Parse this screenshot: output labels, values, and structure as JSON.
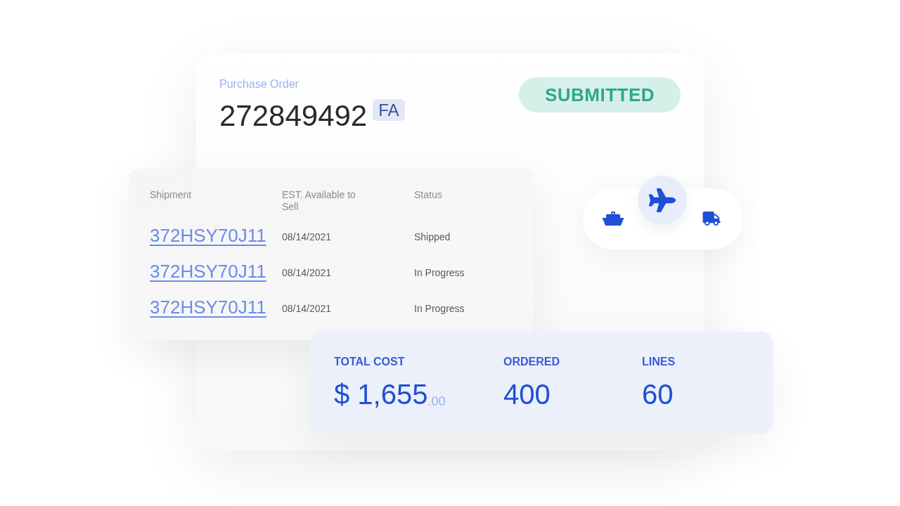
{
  "purchase_order": {
    "label": "Purchase Order",
    "number": "272849492",
    "badge": "FA",
    "status": "SUBMITTED"
  },
  "shipments": {
    "columns": [
      "Shipment",
      "EST. Available to Sell",
      "Status"
    ],
    "rows": [
      {
        "shipment": "372HSY70J11",
        "available": "08/14/2021",
        "status": "Shipped"
      },
      {
        "shipment": "372HSY70J11",
        "available": "08/14/2021",
        "status": "In Progress"
      },
      {
        "shipment": "372HSY70J11",
        "available": "08/14/2021",
        "status": "In Progress"
      }
    ]
  },
  "transport_modes": [
    {
      "kind": "ship",
      "selected": false
    },
    {
      "kind": "plane",
      "selected": true
    },
    {
      "kind": "truck",
      "selected": false
    }
  ],
  "totals": [
    {
      "label": "TOTAL COST",
      "value": "$ 1,655",
      "fraction": ".00"
    },
    {
      "label": "ORDERED",
      "value": "400"
    },
    {
      "label": "LINES",
      "value": "60"
    }
  ]
}
